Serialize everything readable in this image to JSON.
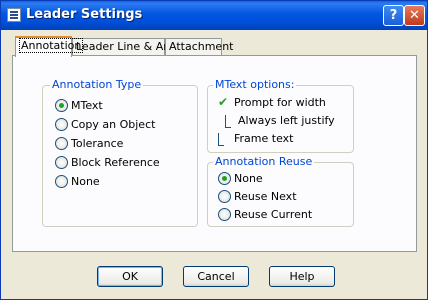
{
  "window": {
    "title": "Leader Settings",
    "help_label": "?",
    "close_label": "✕"
  },
  "tabs": [
    {
      "label": "Annotation"
    },
    {
      "label": "Leader Line & Arrow"
    },
    {
      "label": "Attachment"
    }
  ],
  "annotation_type": {
    "title": "Annotation Type",
    "options": [
      {
        "label": "MText",
        "selected": true
      },
      {
        "label": "Copy an Object",
        "selected": false
      },
      {
        "label": "Tolerance",
        "selected": false
      },
      {
        "label": "Block Reference",
        "selected": false
      },
      {
        "label": "None",
        "selected": false
      }
    ]
  },
  "mtext_options": {
    "title": "MText options:",
    "prompt_for_width": {
      "label": "Prompt for width",
      "checked": true
    },
    "always_left_justify": {
      "label": "Always left justify",
      "checked": false
    },
    "frame_text": {
      "label": "Frame text",
      "checked": false
    }
  },
  "annotation_reuse": {
    "title": "Annotation Reuse",
    "options": [
      {
        "label": "None",
        "selected": true
      },
      {
        "label": "Reuse Next",
        "selected": false
      },
      {
        "label": "Reuse Current",
        "selected": false
      }
    ]
  },
  "buttons": {
    "ok": "OK",
    "cancel": "Cancel",
    "help": "Help"
  }
}
